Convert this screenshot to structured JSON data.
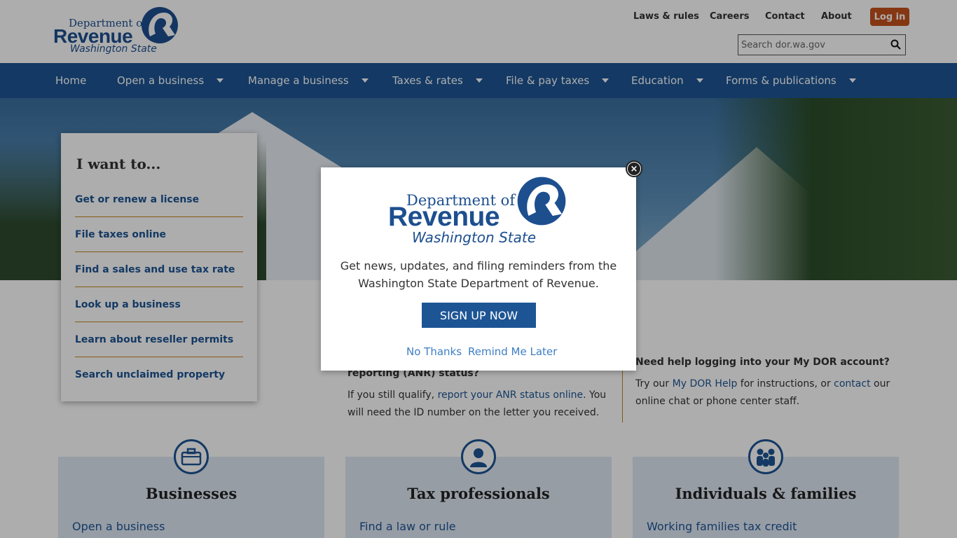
{
  "header": {
    "logo": {
      "line1": "Department of",
      "line2": "Revenue",
      "line3": "Washington State"
    },
    "util_nav": [
      {
        "label": "Laws & rules"
      },
      {
        "label": "Careers"
      },
      {
        "label": "Contact"
      },
      {
        "label": "About"
      }
    ],
    "login_label": "Log in",
    "search_placeholder": "Search dor.wa.gov"
  },
  "nav": [
    {
      "label": "Home",
      "dropdown": false
    },
    {
      "label": "Open a business",
      "dropdown": true
    },
    {
      "label": "Manage a business",
      "dropdown": true
    },
    {
      "label": "Taxes & rates",
      "dropdown": true
    },
    {
      "label": "File & pay taxes",
      "dropdown": true
    },
    {
      "label": "Education",
      "dropdown": true
    },
    {
      "label": "Forms & publications",
      "dropdown": true
    }
  ],
  "iwant": {
    "title": "I want to...",
    "links": [
      "Get or renew a license",
      "File taxes online",
      "Find a sales and use tax rate",
      "Look up a business",
      "Learn about reseller permits",
      "Search unclaimed property"
    ]
  },
  "middle": {
    "heading_tail": "reporting (ANR) status?",
    "text_pre": "If you still qualify, ",
    "link": "report your ANR status online",
    "text_post": ". You",
    "text_line2": "will need the ID number on the letter you received."
  },
  "right": {
    "heading": "Need help logging into your My DOR account?",
    "t1": "Try our ",
    "link1": "My DOR Help",
    "t2": " for instructions, or ",
    "link2": "contact",
    "t3": " our",
    "line2": "online chat or phone center staff."
  },
  "cards": [
    {
      "title": "Businesses",
      "link": "Open a business",
      "icon": "briefcase-icon"
    },
    {
      "title": "Tax professionals",
      "link": "Find a law or rule",
      "icon": "person-icon"
    },
    {
      "title": "Individuals & families",
      "link": "Working families tax credit",
      "icon": "family-icon"
    }
  ],
  "modal": {
    "logo": {
      "line1": "Department of",
      "line2": "Revenue",
      "line3": "Washington State"
    },
    "message": "Get news, updates, and filing reminders from the Washington State Department of Revenue.",
    "signup_label": "SIGN UP NOW",
    "no_thanks": "No Thanks",
    "remind_later": "Remind Me Later"
  },
  "colors": {
    "brand_blue": "#1d5594",
    "login_orange": "#c4521c",
    "accent_gold": "#c4851c"
  }
}
